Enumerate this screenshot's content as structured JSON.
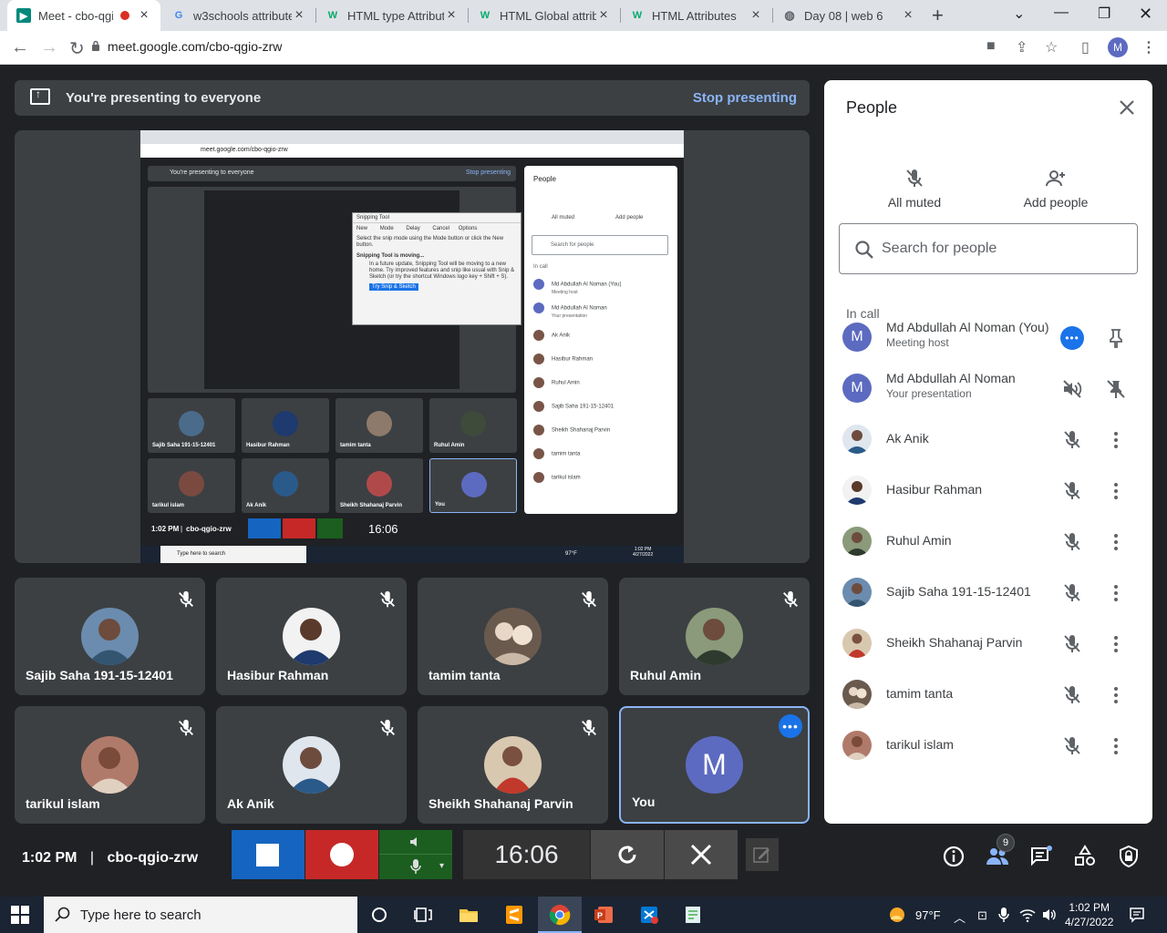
{
  "browser": {
    "tabs": [
      {
        "title": "Meet - cbo-qgio",
        "icon": "google-meet-icon"
      },
      {
        "title": "w3schools attribute",
        "icon": "google-icon"
      },
      {
        "title": "HTML type Attribut",
        "icon": "w3schools-icon"
      },
      {
        "title": "HTML Global attrib",
        "icon": "w3schools-icon"
      },
      {
        "title": "HTML Attributes",
        "icon": "w3schools-icon"
      },
      {
        "title": "Day 08 | web 6",
        "icon": "globe-icon"
      }
    ],
    "url": "meet.google.com/cbo-qgio-zrw",
    "profile_initial": "M"
  },
  "presenting": {
    "message": "You're presenting to everyone",
    "stop_label": "Stop presenting"
  },
  "tiles": [
    {
      "name": "Sajib Saha 191-15-12401",
      "color": "#4a6b8a"
    },
    {
      "name": "Hasibur Rahman",
      "color": "#1e3a6e"
    },
    {
      "name": "tamim tanta",
      "color": "#8d7a6a"
    },
    {
      "name": "Ruhul Amin",
      "color": "#3e4a3a"
    },
    {
      "name": "tarikul islam",
      "color": "#7a4a40"
    },
    {
      "name": "Ak Anik",
      "color": "#2a5a8a"
    },
    {
      "name": "Sheikh Shahanaj Parvin",
      "color": "#b04a4a"
    },
    {
      "name": "You",
      "initial": "M"
    }
  ],
  "meeting": {
    "time": "1:02 PM",
    "separator": "|",
    "code": "cbo-qgio-zrw",
    "timer": "16:06",
    "participant_count": "9"
  },
  "people_panel": {
    "title": "People",
    "all_muted_label": "All muted",
    "add_people_label": "Add people",
    "search_placeholder": "Search for people",
    "in_call_label": "In call",
    "people": [
      {
        "name": "Md Abdullah Al Noman (You)",
        "sub": "Meeting host",
        "initial": "M"
      },
      {
        "name": "Md Abdullah Al Noman",
        "sub": "Your presentation",
        "initial": "M"
      },
      {
        "name": "Ak Anik",
        "color": "#2a5a8a"
      },
      {
        "name": "Hasibur Rahman",
        "color": "#1e3a6e"
      },
      {
        "name": "Ruhul Amin",
        "color": "#3e4a3a"
      },
      {
        "name": "Sajib Saha 191-15-12401",
        "color": "#4a6b8a"
      },
      {
        "name": "Sheikh Shahanaj Parvin",
        "color": "#b04a4a"
      },
      {
        "name": "tamim tanta",
        "color": "#8d7a6a"
      },
      {
        "name": "tarikul islam",
        "color": "#7a4a40"
      }
    ]
  },
  "shot": {
    "url": "meet.google.com/cbo-qgio-zrw",
    "presenting": "You're presenting to everyone",
    "stop": "Stop presenting",
    "snipping_title": "Snipping Tool",
    "snipping_new": "New",
    "snipping_mode": "Mode",
    "snipping_delay": "Delay",
    "snipping_cancel": "Cancel",
    "snipping_options": "Options",
    "snipping_hint": "Select the snip mode using the Mode button or click the New button.",
    "snipping_moving": "Snipping Tool is moving...",
    "snipping_desc": "In a future update, Snipping Tool will be moving to a new home. Try improved features and snip like usual with Snip & Sketch (or try the shortcut Windows logo key + Shift + S).",
    "snipping_try": "Try Snip & Sketch",
    "people_title": "People",
    "all_muted": "All muted",
    "add_people": "Add people",
    "search": "Search for people",
    "in_call": "In call",
    "people": [
      {
        "name": "Md Abdullah Al Noman (You)",
        "sub": "Meeting host"
      },
      {
        "name": "Md Abdullah Al Noman",
        "sub": "Your presentation"
      },
      {
        "name": "Ak Anik"
      },
      {
        "name": "Hasibur Rahman"
      },
      {
        "name": "Ruhul Amin"
      },
      {
        "name": "Sajib Saha 191-15-12401"
      },
      {
        "name": "Sheikh Shahanaj Parvin"
      },
      {
        "name": "tamim tanta"
      },
      {
        "name": "tarikul islam"
      }
    ],
    "tiles": [
      "Sajib Saha 191-15-12401",
      "Hasibur Rahman",
      "tamim tanta",
      "Ruhul Amin",
      "tarikul islam",
      "Ak Anik",
      "Sheikh Shahanaj Parvin",
      "You"
    ],
    "time": "1:02 PM",
    "separator": "|",
    "code": "cbo-qgio-zrw",
    "timer": "16:06",
    "taskbar_search": "Type here to search",
    "weather": "97°F",
    "clock_time": "1:02 PM",
    "clock_date": "4/27/2022"
  },
  "taskbar": {
    "search_placeholder": "Type here to search",
    "weather": "97°F",
    "time": "1:02 PM",
    "date": "4/27/2022"
  },
  "colors": {
    "meet_bg": "#202124",
    "tile_bg": "#3c4043",
    "accent_blue": "#1a73e8",
    "link_blue": "#8ab4f8",
    "stop_blue": "#1565c0",
    "record_red": "#c62828",
    "audio_green": "#1b5e20"
  }
}
